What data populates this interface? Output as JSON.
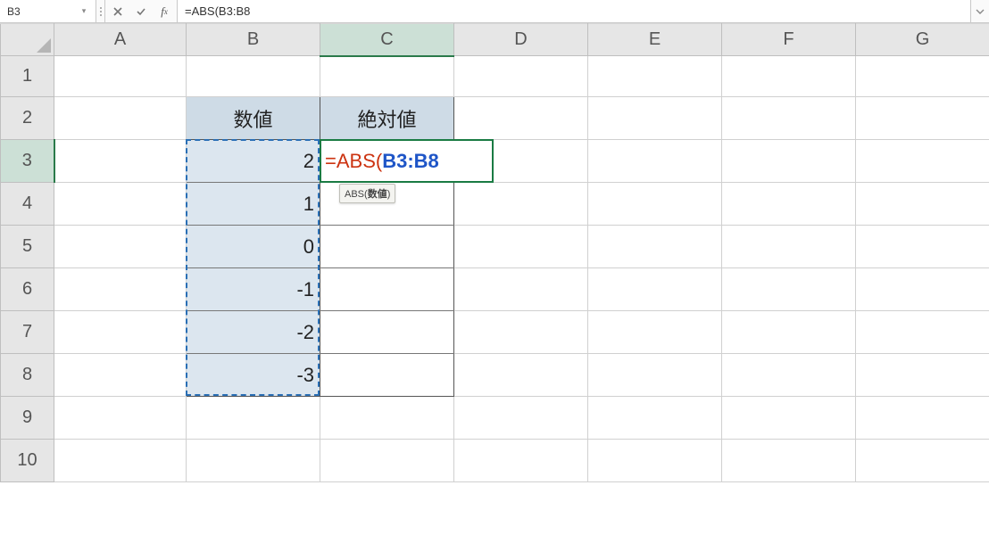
{
  "formula_bar": {
    "name_box": "B3",
    "formula_text": "=ABS(B3:B8"
  },
  "columns": [
    "A",
    "B",
    "C",
    "D",
    "E",
    "F",
    "G"
  ],
  "rows": [
    "1",
    "2",
    "3",
    "4",
    "5",
    "6",
    "7",
    "8",
    "9",
    "10"
  ],
  "selected_col": "C",
  "selected_row": "3",
  "table": {
    "header_b": "数値",
    "header_c": "絶対値",
    "values_b": [
      "2",
      "1",
      "0",
      "-1",
      "-2",
      "-3"
    ]
  },
  "editing_cell": {
    "ref": "C3",
    "parts": {
      "eq": "=",
      "fn_open": "ABS(",
      "range": "B3:B8"
    }
  },
  "fn_tooltip": {
    "fn": "ABS",
    "arg": "数値"
  },
  "marching_range": "B3:B8"
}
